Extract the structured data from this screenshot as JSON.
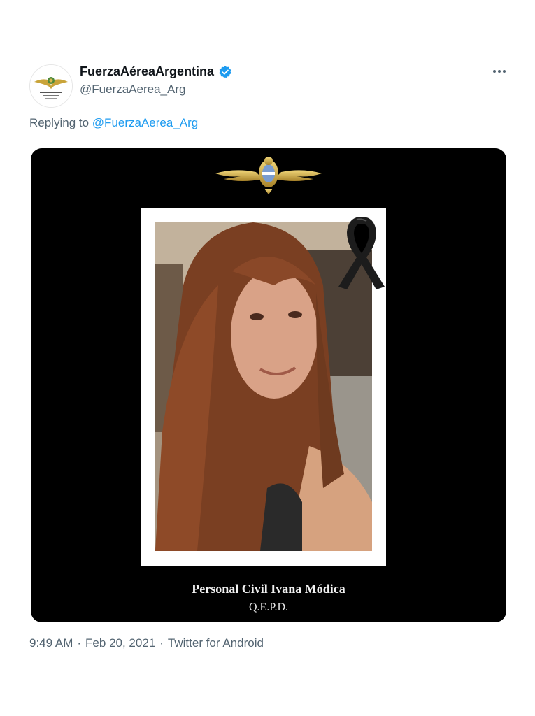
{
  "author": {
    "display_name": "FuerzaAéreaArgentina",
    "handle": "@FuerzaAerea_Arg",
    "verified": true,
    "avatar_icon": "air-force-emblem-icon"
  },
  "replying": {
    "lead": "Replying to",
    "mention": "@FuerzaAerea_Arg"
  },
  "media": {
    "caption_name": "Personal Civil Ivana Módica",
    "caption_rip": "Q.E.P.D.",
    "emblem_icon": "winged-emblem-icon",
    "ribbon_icon": "mourning-ribbon-icon"
  },
  "meta": {
    "time": "9:49 AM",
    "date": "Feb 20, 2021",
    "client": "Twitter for Android",
    "separator": "·"
  },
  "colors": {
    "link": "#1d9bf0",
    "muted": "#536471",
    "verified": "#1d9bf0",
    "media_bg": "#000000"
  }
}
